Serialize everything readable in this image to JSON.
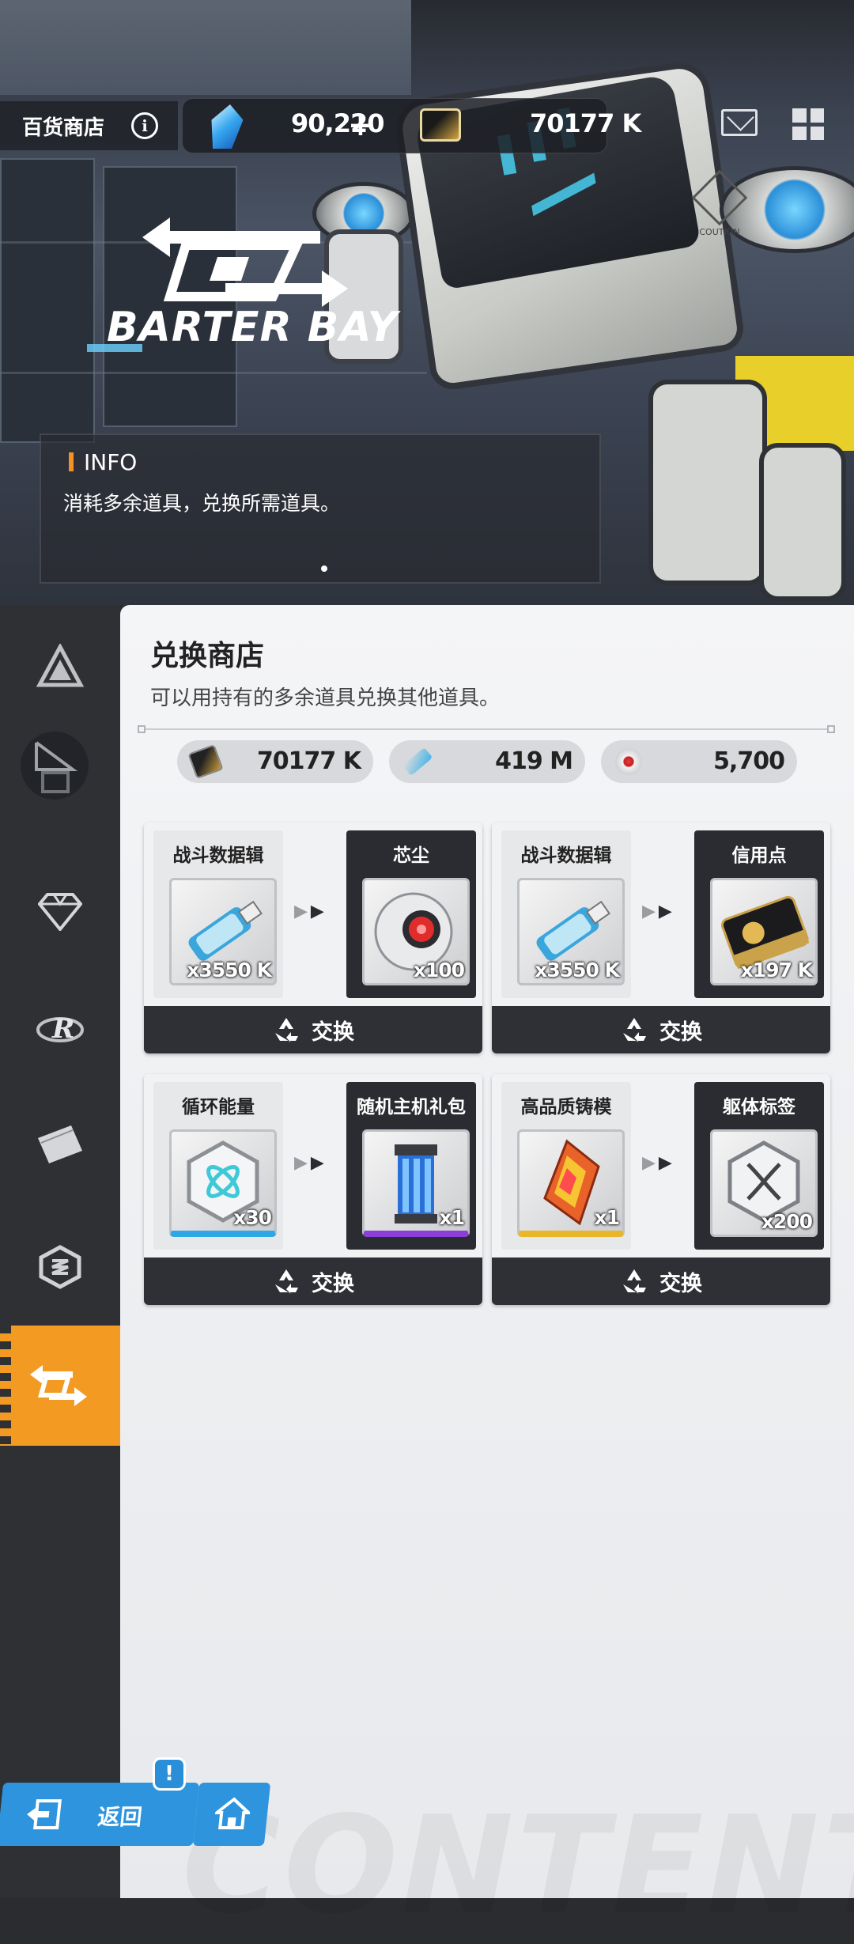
{
  "header": {
    "title": "百货商店",
    "gems": "90,220",
    "credits": "70177 K"
  },
  "banner": {
    "logo_text": "BARTER BAY",
    "info_title": "INFO",
    "info_desc": "消耗多余道具，兑换所需道具。",
    "caution_text": "COUTION"
  },
  "shop": {
    "title": "兑换商店",
    "subtitle": "可以用持有的多余道具兑换其他道具。",
    "currencies": [
      {
        "icon": "credit-card-icon",
        "value": "70177 K"
      },
      {
        "icon": "data-usb-icon",
        "value": "419 M"
      },
      {
        "icon": "core-dust-icon",
        "value": "5,700"
      }
    ],
    "trades": [
      {
        "give_label": "战斗数据辑",
        "give_qty": "x3550 K",
        "get_label": "芯尘",
        "get_qty": "x100",
        "button": "交换"
      },
      {
        "give_label": "战斗数据辑",
        "give_qty": "x3550 K",
        "get_label": "信用点",
        "get_qty": "x197 K",
        "button": "交换"
      },
      {
        "give_label": "循环能量",
        "give_qty": "x30",
        "get_label": "随机主机礼包",
        "get_qty": "x1",
        "button": "交换"
      },
      {
        "give_label": "高品质铸模",
        "give_qty": "x1",
        "get_label": "躯体标签",
        "get_qty": "x200",
        "button": "交换"
      }
    ]
  },
  "footer": {
    "back_label": "返回",
    "badge": "!",
    "watermark": "CONTENT"
  },
  "colors": {
    "accent": "#f39a22",
    "blue": "#2d94dd",
    "dark": "#2f3035"
  }
}
